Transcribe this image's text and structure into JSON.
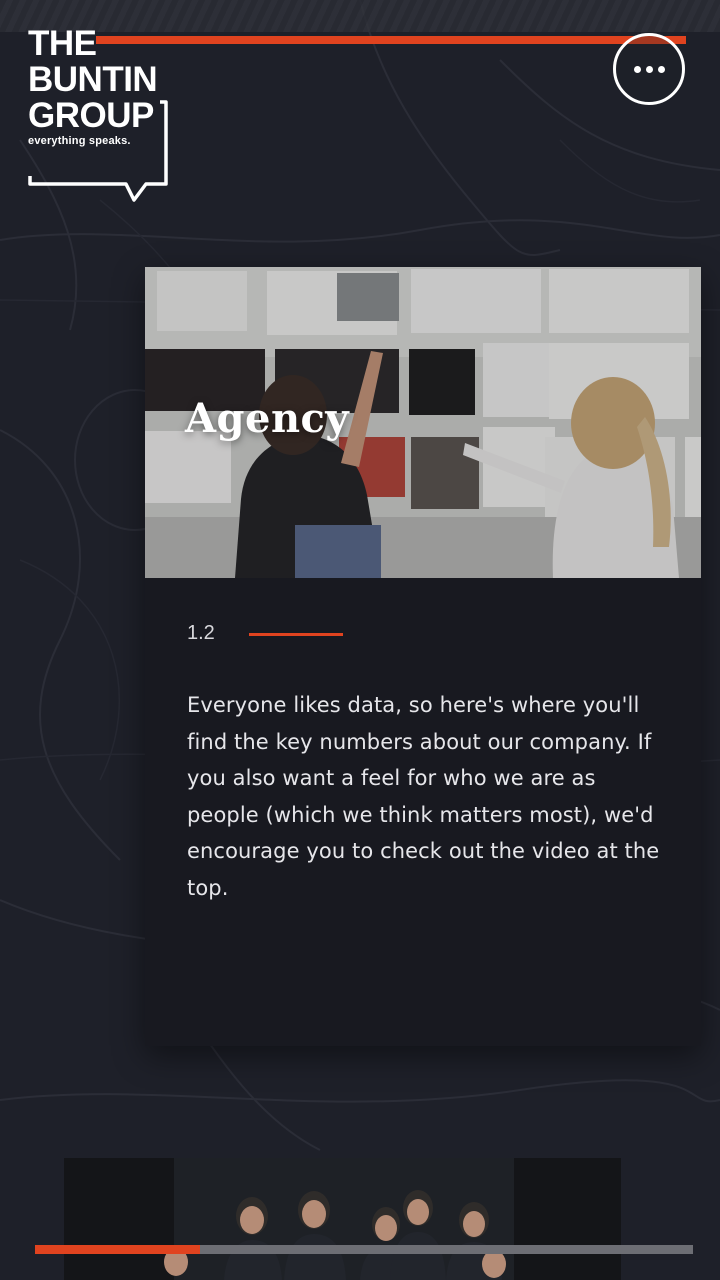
{
  "brand": {
    "logo_lines": [
      "THE",
      "BUNTIN",
      "GROUP"
    ],
    "tagline": "everything speaks."
  },
  "menu": {
    "icon": "more-dots-icon"
  },
  "card": {
    "title": "Agency",
    "section_number": "1.2",
    "body": "Everyone likes data, so here's where you'll find the key numbers about our company. If you also want a feel for who we are as people (which we think matters most), we'd encourage you to check out the video at the top."
  },
  "progress": {
    "fraction": 0.25
  },
  "colors": {
    "accent": "#e0431f",
    "background": "#1e2029",
    "card": "#181920",
    "text": "#e6e6ea"
  }
}
